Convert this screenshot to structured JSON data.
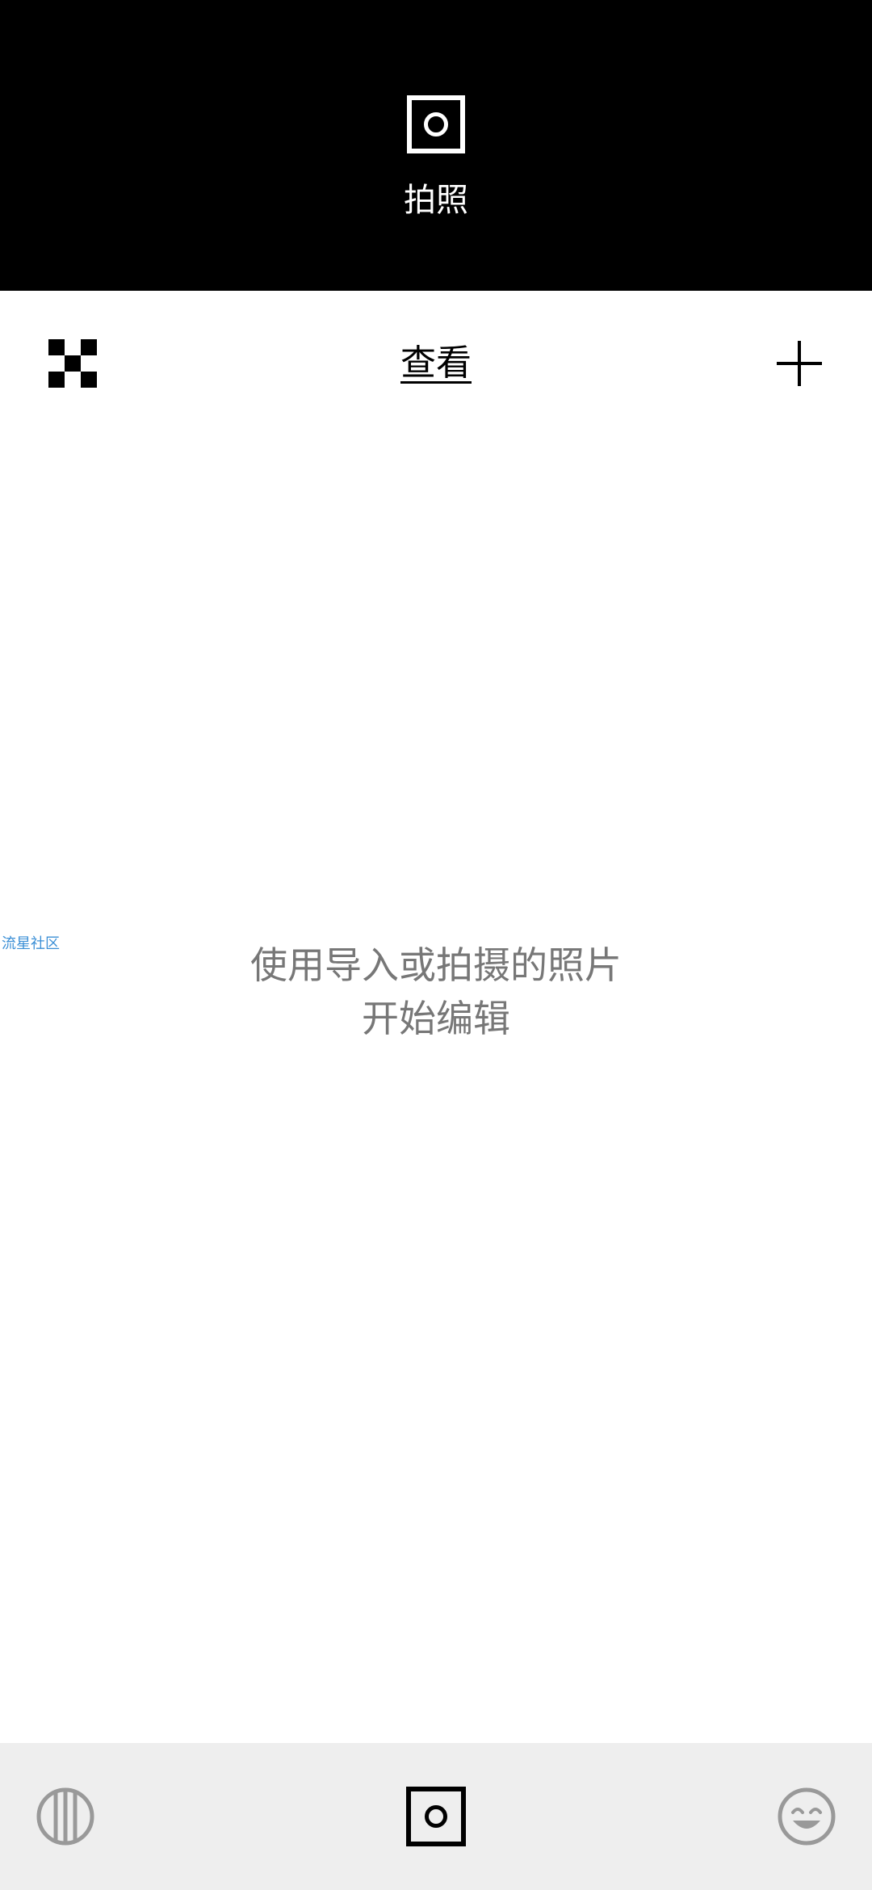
{
  "camera_header": {
    "label": "拍照",
    "icon": "camera-square-icon"
  },
  "toolbar": {
    "left_icon": "checkerboard-icon",
    "title": "查看",
    "right_icon": "plus-icon"
  },
  "side_link": {
    "label": "流星社区"
  },
  "empty_state": {
    "line1": "使用导入或拍摄的照片",
    "line2": "开始编辑"
  },
  "bottom_nav": {
    "items": [
      {
        "icon": "striped-circle-icon"
      },
      {
        "icon": "camera-square-icon"
      },
      {
        "icon": "smiley-face-icon"
      }
    ]
  },
  "colors": {
    "header_bg": "#000000",
    "nav_bg": "#eeeeee",
    "muted_text": "#777777",
    "link": "#3b8fd6",
    "icon_gray": "#999999"
  }
}
